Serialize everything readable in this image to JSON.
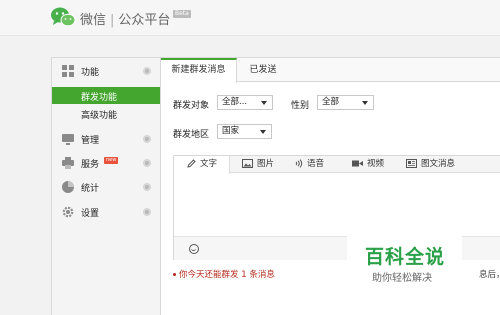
{
  "header": {
    "brand_left": "微信",
    "brand_sep": "|",
    "brand_right": "公众平台",
    "beta": "Beta"
  },
  "sidebar": {
    "sections": [
      {
        "label": "功能",
        "icon": "grid-icon"
      },
      {
        "label": "管理",
        "icon": "monitor-icon"
      },
      {
        "label": "服务",
        "icon": "printer-icon",
        "badge": "new"
      },
      {
        "label": "统计",
        "icon": "pie-chart-icon"
      },
      {
        "label": "设置",
        "icon": "gear-icon"
      }
    ],
    "subitems": [
      {
        "label": "群发功能",
        "active": true
      },
      {
        "label": "高级功能",
        "active": false
      }
    ]
  },
  "main": {
    "tabs": [
      {
        "label": "新建群发消息",
        "active": true
      },
      {
        "label": "已发送",
        "active": false
      }
    ],
    "form": {
      "target_label": "群发对象",
      "target_value": "全部...",
      "gender_label": "性别",
      "gender_value": "全部",
      "region_label": "群发地区",
      "region_value": "国家"
    },
    "editor": {
      "tabs": [
        {
          "label": "文字",
          "icon": "pencil-icon",
          "active": true
        },
        {
          "label": "图片",
          "icon": "image-icon",
          "active": false
        },
        {
          "label": "语音",
          "icon": "audio-icon",
          "active": false
        },
        {
          "label": "视频",
          "icon": "video-icon",
          "active": false
        },
        {
          "label": "图文消息",
          "icon": "article-icon",
          "active": false
        }
      ],
      "emoji_icon": "smiley-icon"
    },
    "notice": "你今天还能群发 1 条消息",
    "notice_right": "息后，"
  },
  "watermark": {
    "title": "百科全说",
    "subtitle": "助你轻松解决"
  },
  "colors": {
    "accent": "#44a62f",
    "notice": "#b52c1e",
    "watermark": "#2aa148"
  }
}
